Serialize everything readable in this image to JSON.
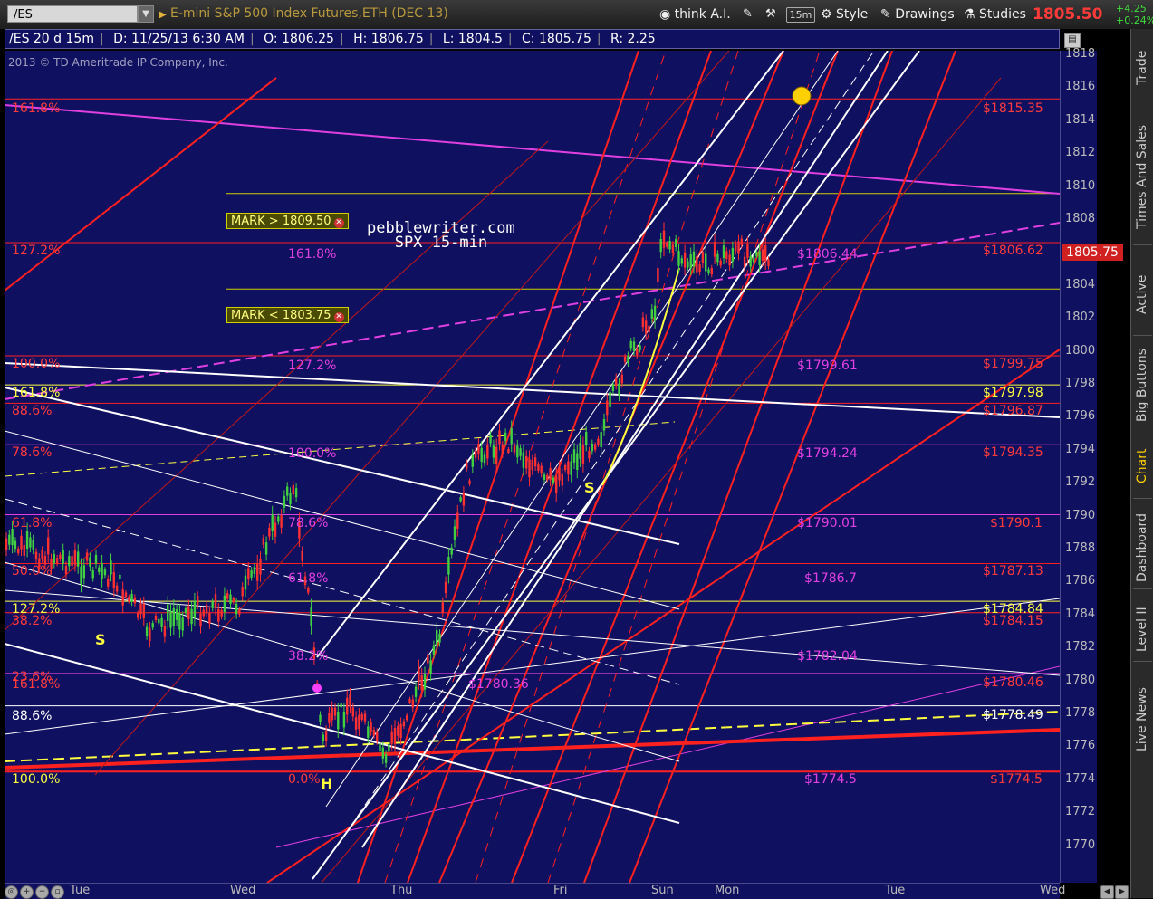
{
  "toolbar": {
    "symbol": "/ES",
    "instrument": "E-mini S&P 500 Index Futures,ETH (DEC 13)",
    "think_ai": "think A.I.",
    "period": "15m",
    "style": "Style",
    "drawings": "Drawings",
    "studies": "Studies",
    "last_price": "1805.50",
    "change": "+4.25",
    "change_pct": "+0.24%"
  },
  "infobar": {
    "symbol": "/ES 20 d 15m",
    "date": "D: 11/25/13 6:30 AM",
    "open": "O: 1806.25",
    "high": "H: 1806.75",
    "low": "L: 1804.5",
    "close": "C: 1805.75",
    "range": "R: 2.25"
  },
  "copyright": "2013 © TD Ameritrade IP Company, Inc.",
  "watermark": {
    "line1": "pebblewriter.com",
    "line2": "SPX 15-min"
  },
  "current_price_tag": "1805.75",
  "marks": [
    {
      "text": "MARK > 1809.50"
    },
    {
      "text": "MARK < 1803.75"
    }
  ],
  "right_labels": [
    {
      "text": "$1815.35",
      "color": "#ff3b3b"
    },
    {
      "text": "$1806.62",
      "color": "#ff3b3b"
    },
    {
      "text": "$1806.44",
      "color": "#e040e0"
    },
    {
      "text": "$1799.75",
      "color": "#ff3b3b"
    },
    {
      "text": "$1799.61",
      "color": "#e040e0"
    },
    {
      "text": "$1797.98",
      "color": "#ffff40"
    },
    {
      "text": "$1796.87",
      "color": "#ff3b3b"
    },
    {
      "text": "$1794.35",
      "color": "#ff3b3b"
    },
    {
      "text": "$1794.24",
      "color": "#e040e0"
    },
    {
      "text": "$1790.1",
      "color": "#ff3b3b"
    },
    {
      "text": "$1790.01",
      "color": "#e040e0"
    },
    {
      "text": "$1787.13",
      "color": "#ff3b3b"
    },
    {
      "text": "$1786.7",
      "color": "#e040e0"
    },
    {
      "text": "$1784.84",
      "color": "#ffff40"
    },
    {
      "text": "$1784.15",
      "color": "#ff3b3b"
    },
    {
      "text": "$1782.04",
      "color": "#e040e0"
    },
    {
      "text": "$1780.46",
      "color": "#ff3b3b"
    },
    {
      "text": "$1780.36",
      "color": "#e040e0"
    },
    {
      "text": "$1778.49",
      "color": "#ffffff"
    },
    {
      "text": "$1774.5",
      "color": "#e040e0"
    },
    {
      "text": "$1774.5",
      "color": "#ff3b3b"
    }
  ],
  "left_fib_labels": [
    {
      "text": "161.8%",
      "color": "#ff3b3b"
    },
    {
      "text": "127.2%",
      "color": "#ff3b3b"
    },
    {
      "text": "100.0%",
      "color": "#ff3b3b"
    },
    {
      "text": "161.8%",
      "color": "#ffff40"
    },
    {
      "text": "88.6%",
      "color": "#ff3b3b"
    },
    {
      "text": "78.6%",
      "color": "#ff3b3b"
    },
    {
      "text": "61.8%",
      "color": "#ff3b3b"
    },
    {
      "text": "50.0%",
      "color": "#ff3b3b"
    },
    {
      "text": "127.2%",
      "color": "#ffff40"
    },
    {
      "text": "38.2%",
      "color": "#ff3b3b"
    },
    {
      "text": "23.6%",
      "color": "#ff3b3b"
    },
    {
      "text": "161.8%",
      "color": "#ff3b3b"
    },
    {
      "text": "88.6%",
      "color": "#ffffff"
    },
    {
      "text": "100.0%",
      "color": "#ffff40"
    },
    {
      "text": "0.0%",
      "color": "#ff3b3b"
    }
  ],
  "mid_fib_labels": [
    {
      "text": "161.8%"
    },
    {
      "text": "127.2%"
    },
    {
      "text": "100.0%"
    },
    {
      "text": "78.6%"
    },
    {
      "text": "61.8%"
    },
    {
      "text": "38.2%"
    },
    {
      "text": "0.0%"
    }
  ],
  "pattern_labels": [
    "S",
    "H",
    "S"
  ],
  "y_ticks": [
    "1818",
    "1816",
    "1814",
    "1812",
    "1810",
    "1808",
    "1806",
    "1804",
    "1802",
    "1800",
    "1798",
    "1796",
    "1794",
    "1792",
    "1790",
    "1788",
    "1786",
    "1784",
    "1782",
    "1780",
    "1778",
    "1776",
    "1774",
    "1772",
    "1770"
  ],
  "x_ticks": [
    "Tue",
    "Wed",
    "Thu",
    "Fri",
    "Sun",
    "Mon",
    "Tue",
    "Wed"
  ],
  "side_tabs": [
    "Trade",
    "Times And Sales",
    "Active Trader",
    "Big Buttons",
    "Chart",
    "Dashboard",
    "Level II",
    "Live News"
  ],
  "colors": {
    "plot_bg": "#101060",
    "red": "#ff2020",
    "magenta": "#e040e0",
    "yellow": "#ffff40",
    "white": "#ffffff",
    "up": "#40d040",
    "down": "#ff3030"
  }
}
